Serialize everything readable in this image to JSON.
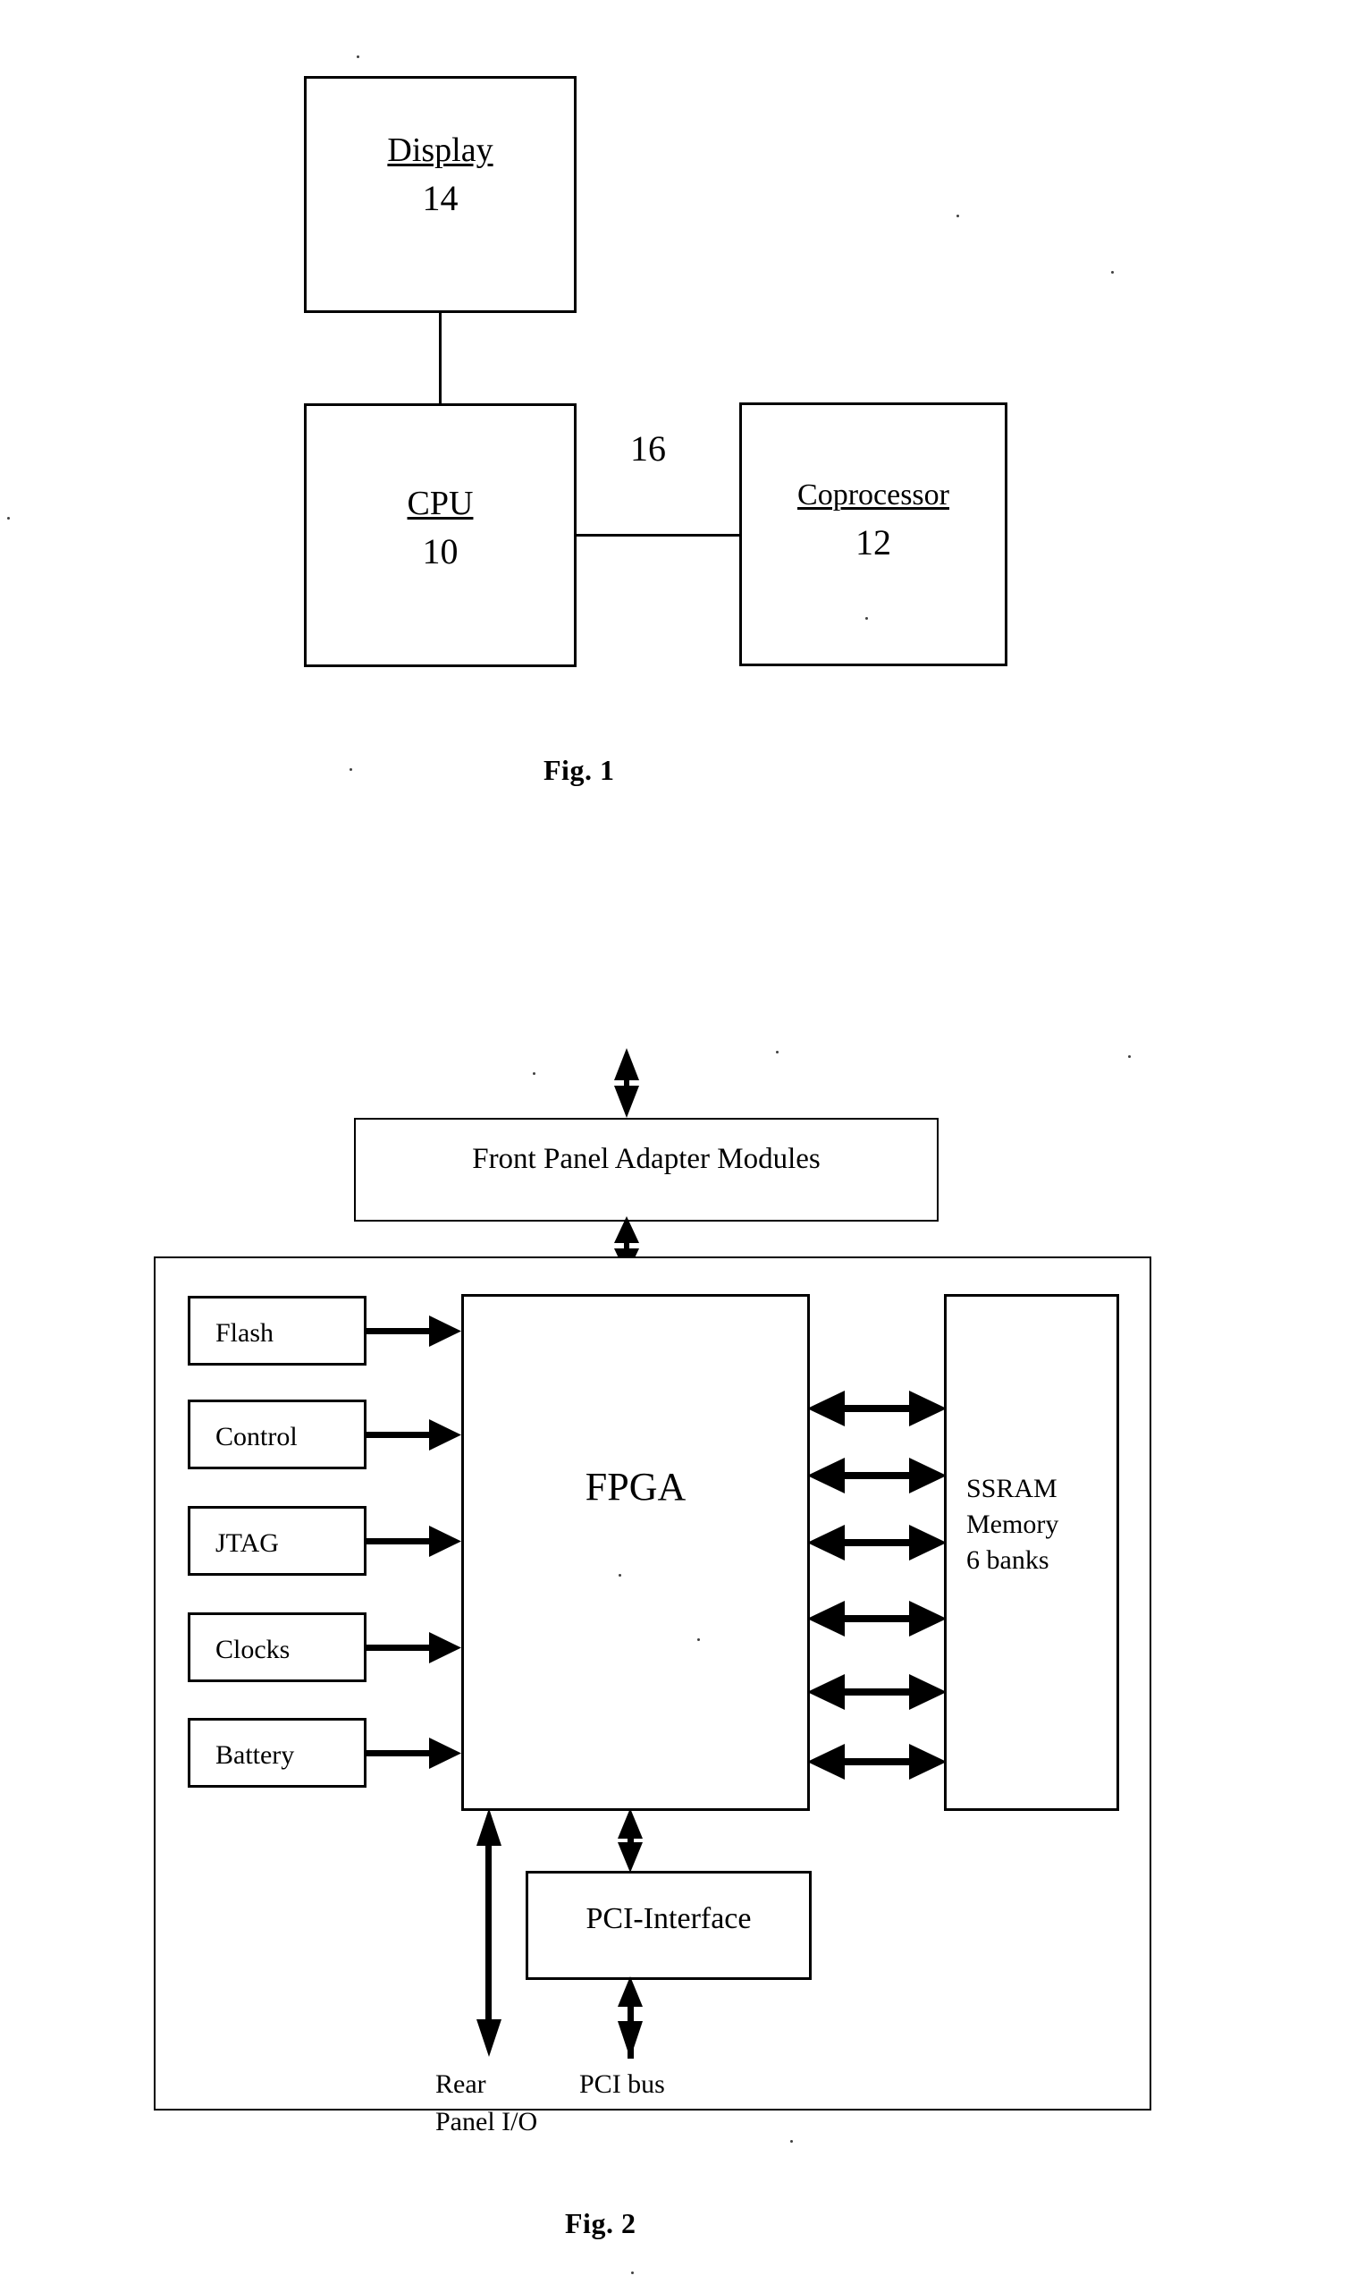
{
  "document": {
    "type": "patent-drawing-sheet",
    "figures": [
      {
        "id": "fig1",
        "caption": "Fig. 1",
        "blocks": [
          {
            "name": "display",
            "label": "Display",
            "ref": "14"
          },
          {
            "name": "cpu",
            "label": "CPU",
            "ref": "10"
          },
          {
            "name": "coprocessor",
            "label": "Coprocessor",
            "ref": "12"
          }
        ],
        "connector_labels": [
          {
            "name": "bus-16",
            "ref": "16"
          }
        ]
      },
      {
        "id": "fig2",
        "caption": "Fig. 2",
        "top_module": {
          "name": "front-panel-adapter-modules",
          "label": "Front Panel Adapter Modules"
        },
        "peripherals": [
          {
            "name": "flash",
            "label": "Flash"
          },
          {
            "name": "control",
            "label": "Control"
          },
          {
            "name": "jtag",
            "label": "JTAG"
          },
          {
            "name": "clocks",
            "label": "Clocks"
          },
          {
            "name": "battery",
            "label": "Battery"
          }
        ],
        "core": {
          "name": "fpga",
          "label": "FPGA"
        },
        "memory": {
          "name": "ssram-memory",
          "line1": "SSRAM",
          "line2": "Memory",
          "line3": "6 banks",
          "bank_links": 6
        },
        "interface": {
          "name": "pci-interface",
          "label": "PCI-Interface"
        },
        "external_ports": [
          {
            "name": "rear-panel-io",
            "line1": "Rear",
            "line2": "Panel I/O"
          },
          {
            "name": "pci-bus",
            "line1": "PCI bus",
            "line2": ""
          }
        ]
      }
    ],
    "colors": {
      "ink": "#000000",
      "paper": "#ffffff"
    }
  }
}
